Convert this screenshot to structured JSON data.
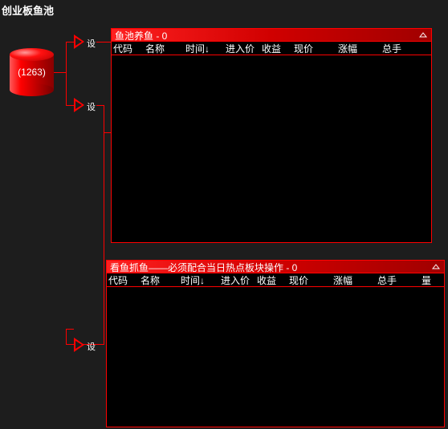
{
  "title": "创业板鱼池",
  "pool": {
    "count_text": "(1263)"
  },
  "arrow_labels": {
    "a1": "设",
    "a2": "设",
    "a3": "设"
  },
  "panel1": {
    "title": "鱼池养鱼 - 0",
    "cols": [
      "代码",
      "名称",
      "时间↓",
      "进入价",
      "收益",
      "现价",
      "涨幅",
      "总手"
    ]
  },
  "panel2": {
    "title": "看鱼抓鱼——必须配合当日热点板块操作 - 0",
    "cols": [
      "代码",
      "名称",
      "时间↓",
      "进入价",
      "收益",
      "现价",
      "涨幅",
      "总手",
      "量"
    ]
  }
}
